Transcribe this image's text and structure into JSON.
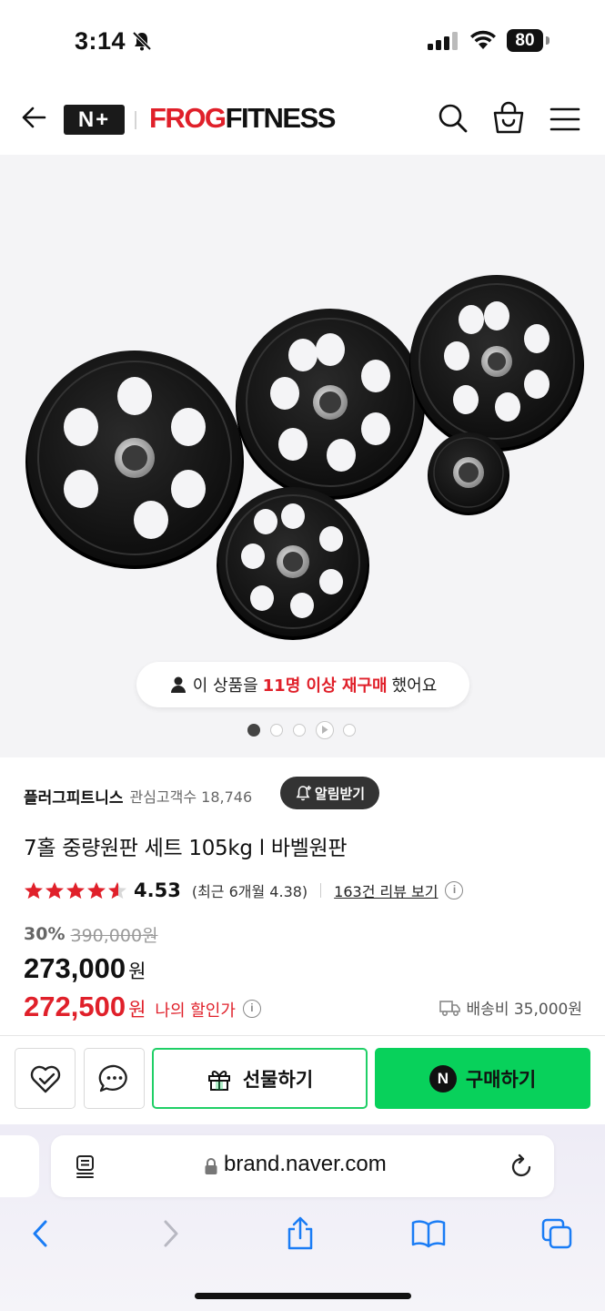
{
  "status_bar": {
    "time": "3:14",
    "battery": "80"
  },
  "header": {
    "np_logo": "N+",
    "brand_red": "FROG",
    "brand_black": "FITNESS",
    "icons": [
      "back-arrow-icon",
      "search-icon",
      "shopping-bag-icon",
      "hamburger-menu-icon"
    ]
  },
  "gallery": {
    "product_image": "black rubber weight plates set",
    "rebuy_prefix": "이 상품을",
    "rebuy_highlight": "11명 이상 재구매",
    "rebuy_suffix": "했어요",
    "slide_count": 5,
    "active_slide": 1
  },
  "store": {
    "name": "플러그피트니스",
    "followers": "관심고객수 18,746",
    "alarm_label": "알림받기"
  },
  "product": {
    "title": "7홀 중량원판 세트 105kg l 바벨원판",
    "rating_value": 4.53,
    "rating_display": "4.53",
    "rating_recent": "(최근 6개월 4.38)",
    "review_link": "163건 리뷰 보기"
  },
  "price": {
    "discount_rate": "30%",
    "original_price": "390,000원",
    "sale_price": "273,000",
    "sale_unit": "원",
    "my_price": "272,500",
    "my_unit": "원",
    "my_label": "나의 할인가",
    "shipping": "배송비 35,000원"
  },
  "purchase_bar": {
    "gift_label": "선물하기",
    "buy_label": "구매하기",
    "buy_badge": "N"
  },
  "browser": {
    "url": "brand.naver.com"
  },
  "colors": {
    "brand_red": "#e0202a",
    "naver_green": "#08d15b",
    "gift_border": "#1fcf66"
  }
}
